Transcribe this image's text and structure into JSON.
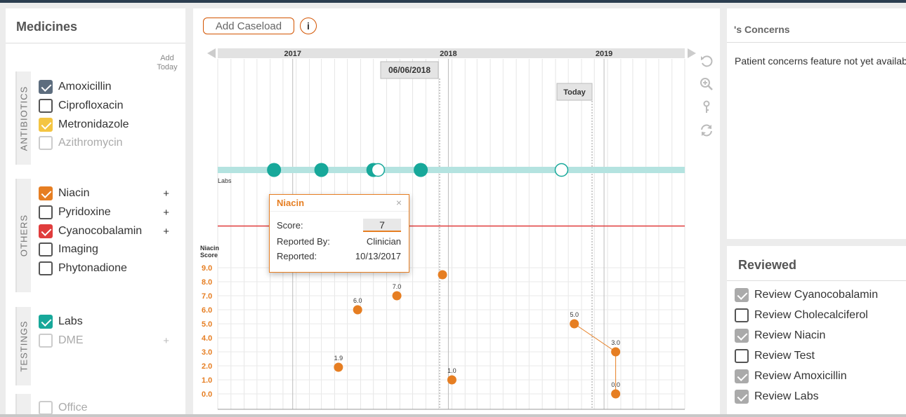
{
  "medicines": {
    "title": "Medicines",
    "add_today": "Add Today",
    "categories": [
      {
        "label": "ANTIBIOTICS"
      },
      {
        "label": "OTHERS"
      },
      {
        "label": "TESTINGS"
      }
    ],
    "items": [
      {
        "label": "Amoxicillin",
        "checked": true,
        "color": "#5d6d7e",
        "dim": false,
        "plus": ""
      },
      {
        "label": "Ciprofloxacin",
        "checked": false,
        "color": "",
        "dim": false,
        "plus": ""
      },
      {
        "label": "Metronidazole",
        "checked": true,
        "color": "#f4c542",
        "dim": false,
        "plus": ""
      },
      {
        "label": "Azithromycin",
        "checked": false,
        "color": "",
        "dim": true,
        "plus": ""
      },
      {
        "label": "Niacin",
        "checked": true,
        "color": "#e67e22",
        "dim": false,
        "plus": "+"
      },
      {
        "label": "Pyridoxine",
        "checked": false,
        "color": "",
        "dim": false,
        "plus": "+"
      },
      {
        "label": "Cyanocobalamin",
        "checked": true,
        "color": "#e03c3c",
        "dim": false,
        "plus": "+"
      },
      {
        "label": "Imaging",
        "checked": false,
        "color": "",
        "dim": false,
        "plus": ""
      },
      {
        "label": "Phytonadione",
        "checked": false,
        "color": "",
        "dim": false,
        "plus": ""
      },
      {
        "label": "Labs",
        "checked": true,
        "color": "#17a89a",
        "dim": false,
        "plus": ""
      },
      {
        "label": "DME",
        "checked": false,
        "color": "",
        "dim": true,
        "plus": "+"
      },
      {
        "label": "Office",
        "checked": false,
        "color": "",
        "dim": true,
        "plus": ""
      }
    ]
  },
  "toolbar": {
    "add_caseload": "Add Caseload",
    "info": "i"
  },
  "timeline": {
    "years": [
      "2017",
      "2018",
      "2019"
    ],
    "selected_date": "06/06/2018",
    "today_label": "Today",
    "labs_label": "Labs",
    "score_axis_label": [
      "Niacin",
      "Score"
    ],
    "y_ticks": [
      "9.0",
      "8.0",
      "7.0",
      "6.0",
      "5.0",
      "4.0",
      "3.0",
      "2.0",
      "1.0",
      "0.0"
    ],
    "tools": [
      "undo-icon",
      "zoom-in-icon",
      "key-icon",
      "refresh-icon"
    ]
  },
  "popup": {
    "title": "Niacin",
    "close": "×",
    "score_label": "Score:",
    "score_value": "7",
    "reported_by_label": "Reported By:",
    "reported_by_value": "Clinician",
    "reported_label": "Reported:",
    "reported_value": "10/13/2017"
  },
  "chart_data": {
    "type": "scatter",
    "title": "",
    "ylabel": "Niacin Score",
    "ylim": [
      0,
      9
    ],
    "x_axis": "date",
    "x_range": [
      "2016-07-01",
      "2019-07-01"
    ],
    "labs_events": [
      {
        "x": "2016-11-10",
        "filled": true
      },
      {
        "x": "2017-03-01",
        "filled": true
      },
      {
        "x": "2017-07-01",
        "filled": "half"
      },
      {
        "x": "2017-07-12",
        "filled": false
      },
      {
        "x": "2017-10-20",
        "filled": true
      },
      {
        "x": "2018-09-15",
        "filled": false
      }
    ],
    "cyanocobalamin_marker": {
      "x": "2016-12-15",
      "color": "#e03c3c"
    },
    "series": [
      {
        "name": "Niacin",
        "color": "#e67e22",
        "points": [
          {
            "x": "2017-04-10",
            "y": 1.9,
            "label": "1.9"
          },
          {
            "x": "2017-05-25",
            "y": 6.0,
            "label": "6.0"
          },
          {
            "x": "2017-08-25",
            "y": 7.0,
            "label": "7.0"
          },
          {
            "x": "2017-12-10",
            "y": 8.5,
            "label": ""
          },
          {
            "x": "2018-01-01",
            "y": 1.0,
            "label": "1.0"
          },
          {
            "x": "2018-10-15",
            "y": 5.0,
            "label": "5.0"
          },
          {
            "x": "2019-01-20",
            "y": 3.0,
            "label": "3.0"
          },
          {
            "x": "2019-01-20",
            "y": 0.0,
            "label": "0.0"
          }
        ]
      }
    ]
  },
  "concerns": {
    "title": "'s Concerns",
    "message": "Patient concerns feature not yet available"
  },
  "reviewed": {
    "title": "Reviewed",
    "items": [
      {
        "label": "Review Cyanocobalamin",
        "checked": true
      },
      {
        "label": "Review Cholecalciferol",
        "checked": false
      },
      {
        "label": "Review Niacin",
        "checked": true
      },
      {
        "label": "Review Test",
        "checked": false
      },
      {
        "label": "Review Amoxicillin",
        "checked": true
      },
      {
        "label": "Review Labs",
        "checked": true
      }
    ]
  }
}
